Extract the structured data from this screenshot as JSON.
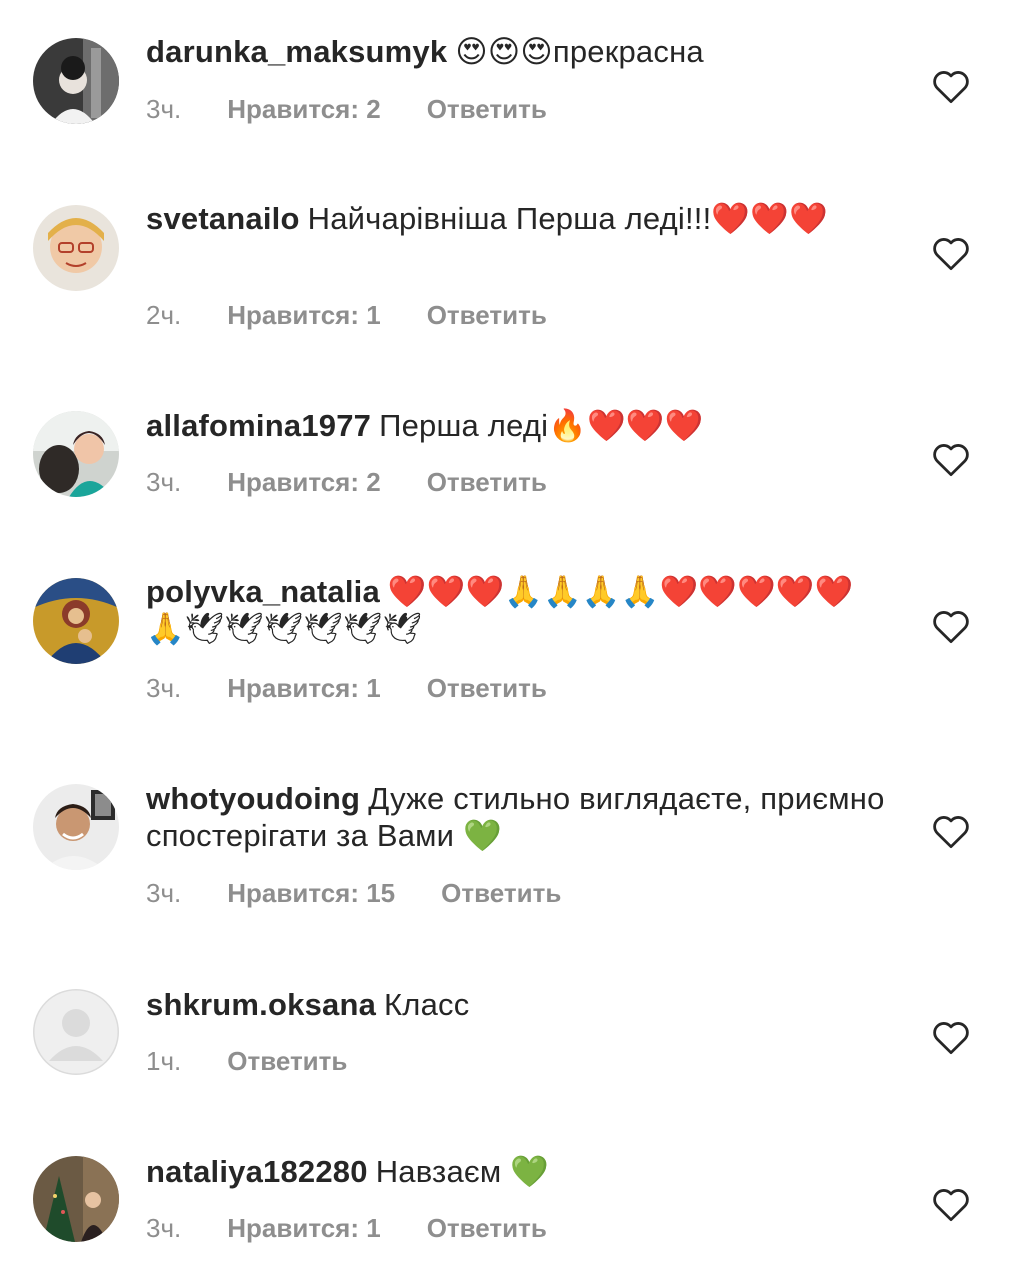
{
  "comments": [
    {
      "username": "darunka_maksumyk",
      "text": "😍😍😍прекрасна",
      "time": "3ч.",
      "likes": "Нравится: 2",
      "reply": "Ответить"
    },
    {
      "username": "svetanailo",
      "text": "Найчарівніша Перша леді!!!❤️❤️❤️",
      "time": "2ч.",
      "likes": "Нравится: 1",
      "reply": "Ответить"
    },
    {
      "username": "allafomina1977",
      "text": "Перша леді🔥❤️❤️❤️",
      "time": "3ч.",
      "likes": "Нравится: 2",
      "reply": "Ответить"
    },
    {
      "username": "polyvka_natalia",
      "text": "❤️❤️❤️🙏🙏🙏🙏❤️❤️❤️❤️❤️🙏🕊🕊🕊🕊🕊🕊",
      "time": "3ч.",
      "likes": "Нравится: 1",
      "reply": "Ответить"
    },
    {
      "username": "whotyoudoing",
      "text": "Дуже стильно виглядаєте, приємно спостерігати за Вами 💚",
      "time": "3ч.",
      "likes": "Нравится: 15",
      "reply": "Ответить"
    },
    {
      "username": "shkrum.oksana",
      "text": "Класс",
      "time": "1ч.",
      "likes": "",
      "reply": "Ответить"
    },
    {
      "username": "nataliya182280",
      "text": "Навзаєм 💚",
      "time": "3ч.",
      "likes": "Нравится: 1",
      "reply": "Ответить"
    }
  ],
  "icons": {
    "like": "heart-outline-icon",
    "avatar_placeholder": "default-avatar-icon"
  },
  "colors": {
    "text": "#262626",
    "meta": "#8e8e8e",
    "heart_stroke": "#262626",
    "placeholder_bg": "#dbdbdb"
  }
}
